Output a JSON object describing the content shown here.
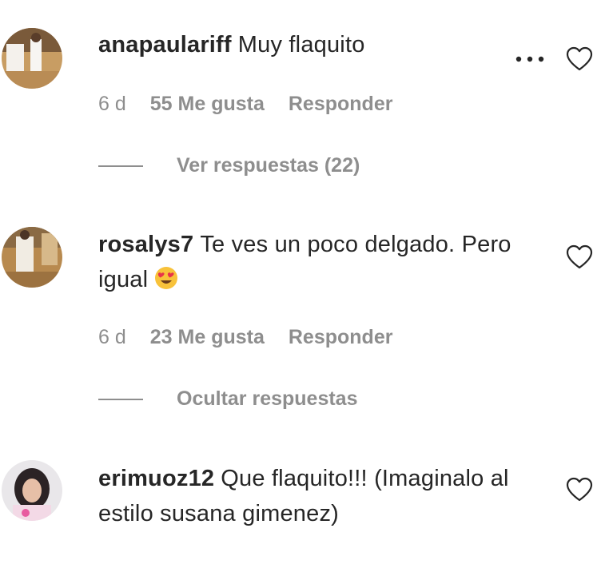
{
  "comments": [
    {
      "username": "anapaulariff",
      "text": "Muy flaquito",
      "time": "6 d",
      "likes": "55 Me gusta",
      "reply_label": "Responder",
      "replies_toggle": "Ver respuestas (22)"
    },
    {
      "username": "rosalys7",
      "text": "Te ves un poco delgado. Pero igual",
      "emoji": "heart-eyes-emoji",
      "time": "6 d",
      "likes": "23 Me gusta",
      "reply_label": "Responder",
      "replies_toggle": "Ocultar respuestas"
    },
    {
      "username": "erimuoz12",
      "text": "Que flaquito!!! (Imaginalo al estilo susana gimenez)"
    }
  ],
  "icons": {
    "like": "heart-outline-icon",
    "options": "more-options-icon"
  },
  "colors": {
    "text": "#262626",
    "secondary": "#8e8e8e"
  }
}
